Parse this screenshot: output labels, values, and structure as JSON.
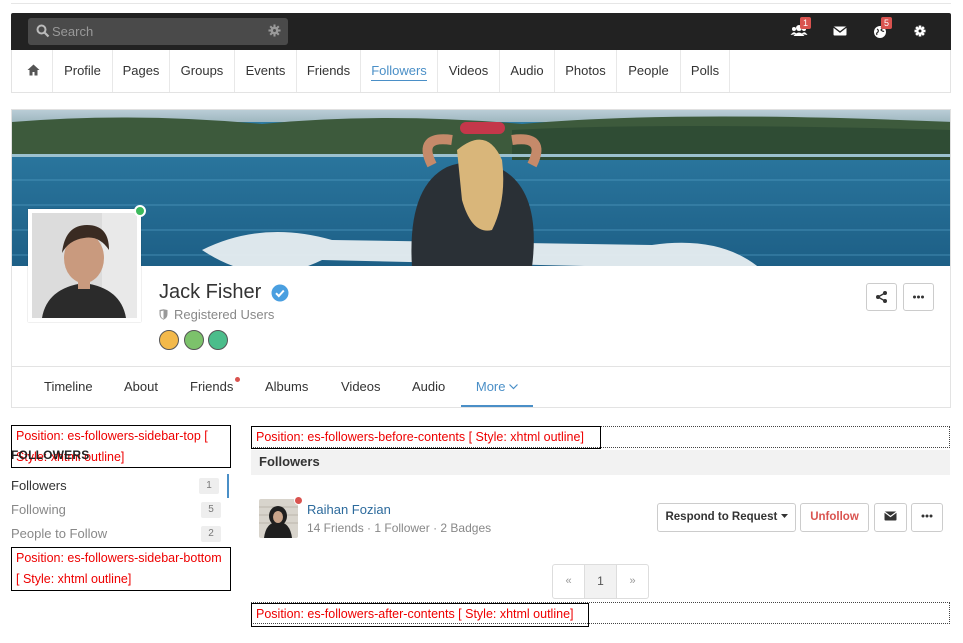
{
  "topbar": {
    "search_placeholder": "Search",
    "friends_badge": "1",
    "notifications_badge": "5"
  },
  "subnav": {
    "items": [
      "Profile",
      "Pages",
      "Groups",
      "Events",
      "Friends",
      "Followers",
      "Videos",
      "Audio",
      "Photos",
      "People",
      "Polls"
    ],
    "active": "Followers"
  },
  "profile": {
    "name": "Jack Fisher",
    "role": "Registered Users"
  },
  "tabs": [
    "Timeline",
    "About",
    "Friends",
    "Albums",
    "Videos",
    "Audio",
    "More"
  ],
  "positions": {
    "sidebar_top": "Position: es-followers-sidebar-top [ Style: xhtml outline]",
    "sidebar_bottom": "Position: es-followers-sidebar-bottom [ Style: xhtml outline]",
    "before_contents": "Position: es-followers-before-contents [ Style: xhtml outline]",
    "after_contents": "Position: es-followers-after-contents [ Style: xhtml outline]"
  },
  "sidebar": {
    "title": "FOLLOWERS",
    "items": [
      {
        "label": "Followers",
        "count": "1"
      },
      {
        "label": "Following",
        "count": "5"
      },
      {
        "label": "People to Follow",
        "count": "2"
      }
    ]
  },
  "content": {
    "heading": "Followers",
    "follower": {
      "name": "Raihan Fozian",
      "friends": "14 Friends",
      "followers": "1 Follower",
      "badges": "2 Badges"
    },
    "buttons": {
      "respond": "Respond to Request",
      "unfollow": "Unfollow"
    },
    "pager": {
      "prev": "«",
      "page": "1",
      "next": "»"
    }
  },
  "colors": {
    "accent": "#4a8fc7",
    "danger": "#d9534f",
    "online": "#3cb95c"
  }
}
